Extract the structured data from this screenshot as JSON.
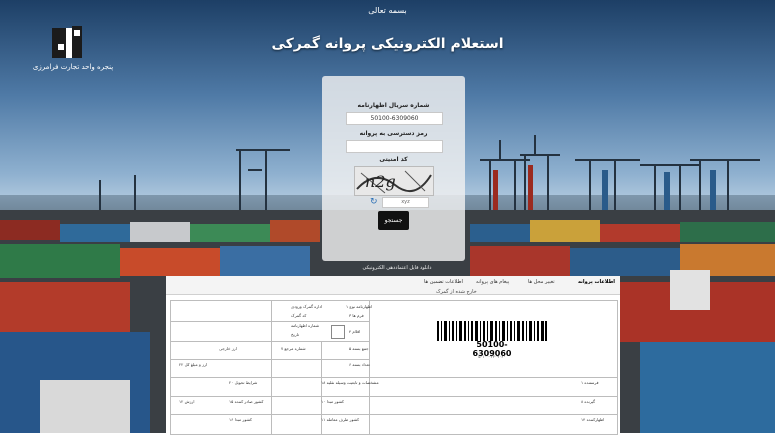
{
  "header": {
    "bismillah": "بسمه تعالی",
    "title": "استعلام الکترونیکی پروانه گمرکی",
    "logo_caption": "پنجره واحد تجارت فرامرزی"
  },
  "login": {
    "serial_label": "شماره سریال اظهارنامه",
    "serial_value": "50100-6309060",
    "password_label": "رمز دسترسی به پروانه",
    "password_value": "",
    "security_label": "کد امنیتی",
    "captcha_text": "n2g",
    "captcha_input": "xyz",
    "submit_label": "جستجو",
    "guide_link": "دانلود فایل اعتماددهی الکترونیکی"
  },
  "panel": {
    "tabs": [
      "اطلاعات پروانه",
      "تغییر محل ها",
      "پیغام های پروانه",
      "اطلاعات تضمین ها",
      "خارج شده از گمرک"
    ],
    "barcode_number": "50100-6309060",
    "barcode_sub": "۵۰۱۰۰-۶۳۰۹۰۶۰"
  },
  "doc_cells": {
    "c1": "۱ فرستنده",
    "c2": "۳ فرم ها",
    "c3": "۴ اقلام",
    "c4": "۵ جمع بسته",
    "c5": "۶ تعداد بسته",
    "c6": "۷ شماره مرجع",
    "c7": "۸ گیرنده",
    "c8": "۱۰ کشور مبدا",
    "c9": "۱۱ کشور طرف معامله",
    "c10": "۱۲ ارزش",
    "c11": "۱۵ کشور صادر کننده",
    "c12": "۱۶ کشور مبدا",
    "c13": "اظهارنامه نوع ۱",
    "c14": "اداره گمرک ورودی",
    "c15": "شماره اظهارنامه",
    "c16": "تاریخ",
    "c17": "کد گمرک",
    "c18": "۱۴ اظهارکننده",
    "c19": "۱۸ مشخصات و تابعیت وسیله نقلیه",
    "c20": "۲۰ شرایط تحویل",
    "c21": "۲۲ ارز و مبلغ کل",
    "c22": "ارز خارجی"
  },
  "colors": {
    "submit_bg": "#111111",
    "panel_bg": "#ffffff",
    "sky": "#4f7aa6"
  }
}
